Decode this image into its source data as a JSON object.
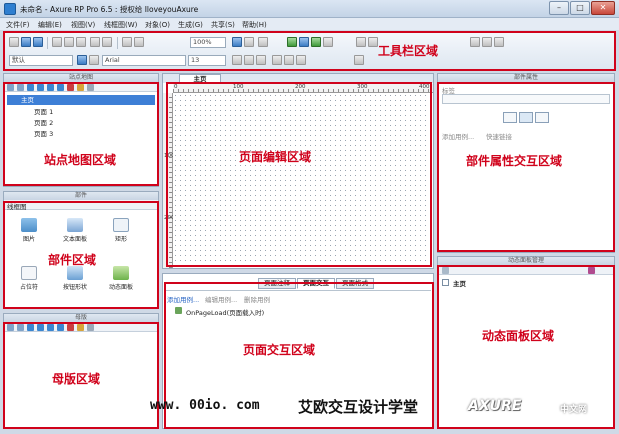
{
  "window": {
    "title": "未命名 - Axure RP Pro 6.5 : 授权给 IloveyouAxure",
    "controls": [
      "–",
      "□",
      "✕"
    ]
  },
  "menu": [
    "文件(F)",
    "编辑(E)",
    "视图(V)",
    "线框图(W)",
    "对象(O)",
    "生成(G)",
    "共享(S)",
    "帮助(H)"
  ],
  "toolbar": {
    "zoom": "100%",
    "style_select": "默认",
    "font_select": "Arial",
    "font_size": "13"
  },
  "sitemap": {
    "header": "站点地图",
    "root": "主页",
    "pages": [
      "页面 1",
      "页面 2",
      "页面 3"
    ]
  },
  "widgets": {
    "header": "部件",
    "library": "线框图",
    "items": [
      {
        "label": "图片",
        "icon": "image-icon"
      },
      {
        "label": "文本面板",
        "icon": "text-panel-icon"
      },
      {
        "label": "矩形",
        "icon": "rectangle-icon"
      },
      {
        "label": "占位符",
        "icon": "placeholder-icon"
      },
      {
        "label": "按钮形状",
        "icon": "button-shape-icon"
      },
      {
        "label": "动态面板",
        "icon": "dynamic-panel-icon"
      }
    ]
  },
  "masters": {
    "header": "母版"
  },
  "editor": {
    "tab": "主页",
    "ruler_top": [
      "0",
      "100",
      "200",
      "300",
      "400"
    ],
    "ruler_left": [
      "100",
      "200"
    ]
  },
  "page_interaction": {
    "tabs": [
      "页面注释",
      "页面交互",
      "页面格式"
    ],
    "active_tab": "页面交互",
    "actions": [
      "添加用例...",
      "编辑用例...",
      "删除用例"
    ],
    "event": "OnPageLoad(页面载入时)"
  },
  "properties": {
    "header": "部件属性",
    "label_field": "标签",
    "links": [
      "添加用例...",
      "快速链接"
    ]
  },
  "dynamic_panels": {
    "header": "动态面板管理",
    "root": "主页"
  },
  "annotations": {
    "toolbar": "工具栏区域",
    "sitemap": "站点地图区域",
    "widgets": "部件区域",
    "masters": "母版区域",
    "editor": "页面编辑区域",
    "interaction": "页面交互区域",
    "properties": "部件属性交互区域",
    "dynamic": "动态面板区域"
  },
  "watermark": {
    "site": "www. 00io. com",
    "school": "艾欧交互设计学堂",
    "brand": "AXURE",
    "brand_sub": "中文网"
  },
  "colors": {
    "annotation_red": "#d0021b",
    "selection_blue": "#3d7fd6",
    "chrome": "#cfd9e6"
  }
}
